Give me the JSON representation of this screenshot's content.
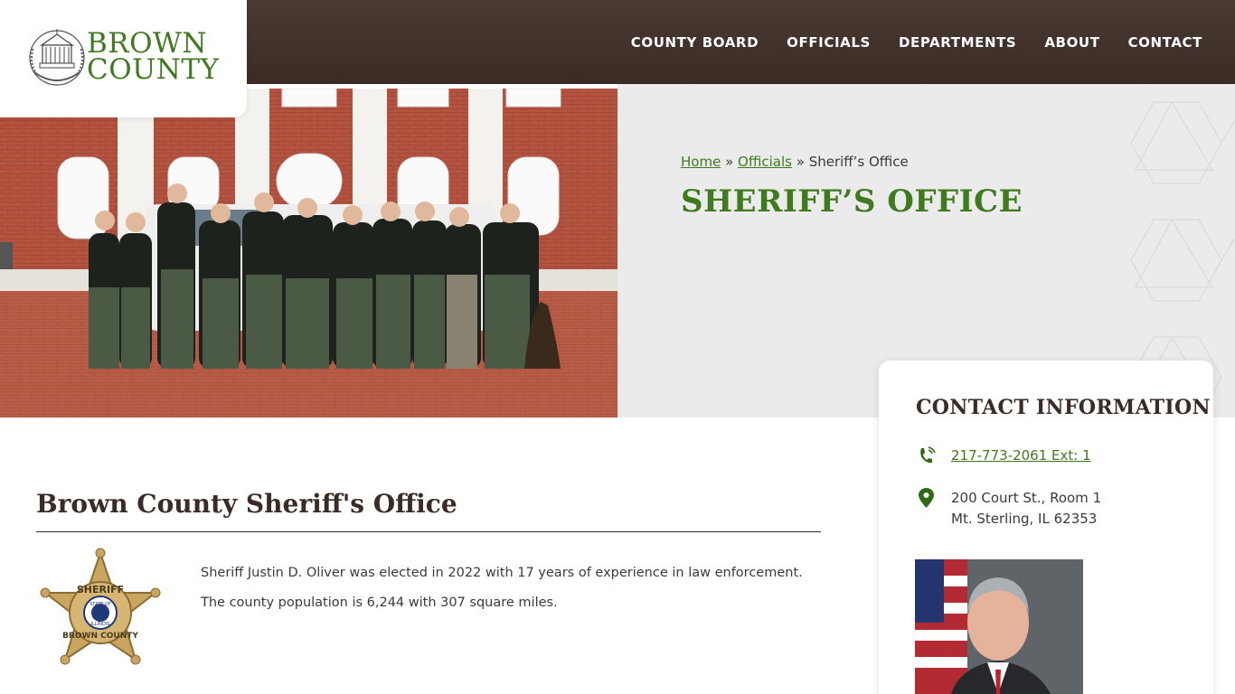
{
  "brand": {
    "line1": "BROWN",
    "line2": "COUNTY",
    "color": "#3f7a1c"
  },
  "nav": {
    "items": [
      {
        "label": "COUNTY BOARD"
      },
      {
        "label": "OFFICIALS"
      },
      {
        "label": "DEPARTMENTS"
      },
      {
        "label": "ABOUT"
      },
      {
        "label": "CONTACT"
      }
    ]
  },
  "breadcrumb": {
    "home": "Home",
    "sep1": "»",
    "officials": "Officials",
    "sep2": "»",
    "current": "Sheriff’s Office"
  },
  "page": {
    "title": "SHERIFF’S OFFICE"
  },
  "section": {
    "title": "Brown County Sheriff's Office",
    "paragraphs": [
      "Sheriff Justin D. Oliver was elected in 2022 with 17 years of experience in law enforcement.",
      "The county population is 6,244 with 307 square miles."
    ]
  },
  "badge": {
    "top": "SHERIFF",
    "bottom": "BROWN COUNTY",
    "center_top": "STATE OF",
    "center_bottom": "ILLINOIS"
  },
  "contact": {
    "title": "CONTACT INFORMATION",
    "phone": "217-773-2061 Ext: 1",
    "address_line1": "200 Court St., Room 1",
    "address_line2": "Mt. Sterling, IL 62353"
  },
  "colors": {
    "header": "#3a2b25",
    "accent": "#3f7a1c",
    "hero_bg": "#ebebeb"
  },
  "icons": [
    "phone-icon",
    "map-pin-icon"
  ]
}
